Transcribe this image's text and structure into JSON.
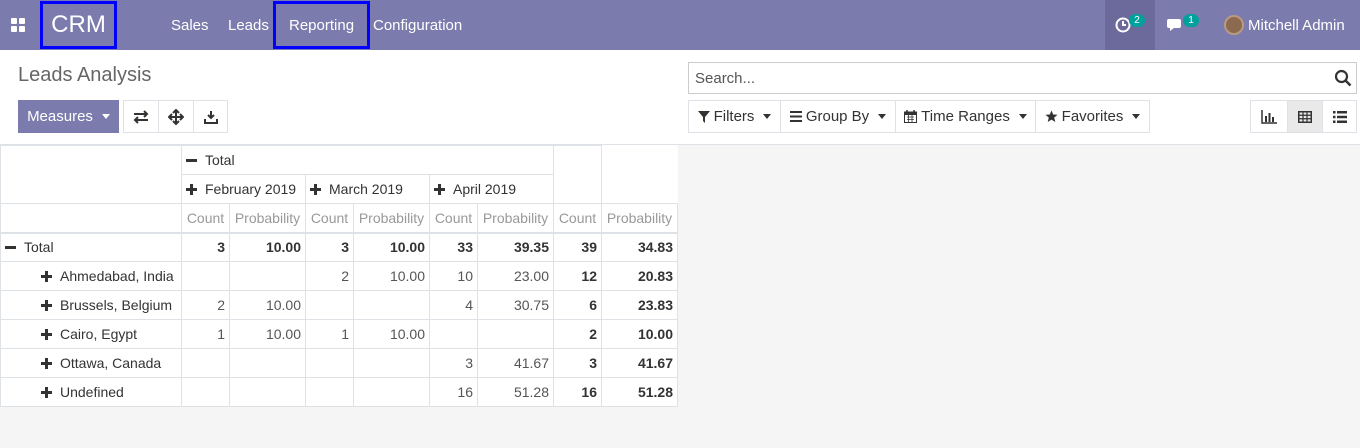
{
  "navbar": {
    "brand": "CRM",
    "menu": [
      "Sales",
      "Leads",
      "Reporting",
      "Configuration"
    ],
    "activity_count": "2",
    "message_count": "1",
    "user_name": "Mitchell Admin",
    "color": "#7c7bad"
  },
  "control": {
    "title": "Leads Analysis",
    "search_placeholder": "Search...",
    "measures_label": "Measures",
    "filters_label": "Filters",
    "groupby_label": "Group By",
    "timeranges_label": "Time Ranges",
    "favorites_label": "Favorites"
  },
  "pivot": {
    "col_total_label": "Total",
    "col_groups": [
      "February 2019",
      "March 2019",
      "April 2019"
    ],
    "measure_labels": [
      "Count",
      "Probability"
    ],
    "row_total_label": "Total",
    "total_row": [
      "3",
      "10.00",
      "3",
      "10.00",
      "33",
      "39.35",
      "39",
      "34.83"
    ],
    "rows": [
      {
        "label": "Ahmedabad, India",
        "cells": [
          "",
          "",
          "2",
          "10.00",
          "10",
          "23.00",
          "12",
          "20.83"
        ]
      },
      {
        "label": "Brussels, Belgium",
        "cells": [
          "2",
          "10.00",
          "",
          "",
          "4",
          "30.75",
          "6",
          "23.83"
        ]
      },
      {
        "label": "Cairo, Egypt",
        "cells": [
          "1",
          "10.00",
          "1",
          "10.00",
          "",
          "",
          "2",
          "10.00"
        ]
      },
      {
        "label": "Ottawa, Canada",
        "cells": [
          "",
          "",
          "",
          "",
          "3",
          "41.67",
          "3",
          "41.67"
        ]
      },
      {
        "label": "Undefined",
        "cells": [
          "",
          "",
          "",
          "",
          "16",
          "51.28",
          "16",
          "51.28"
        ]
      }
    ]
  }
}
